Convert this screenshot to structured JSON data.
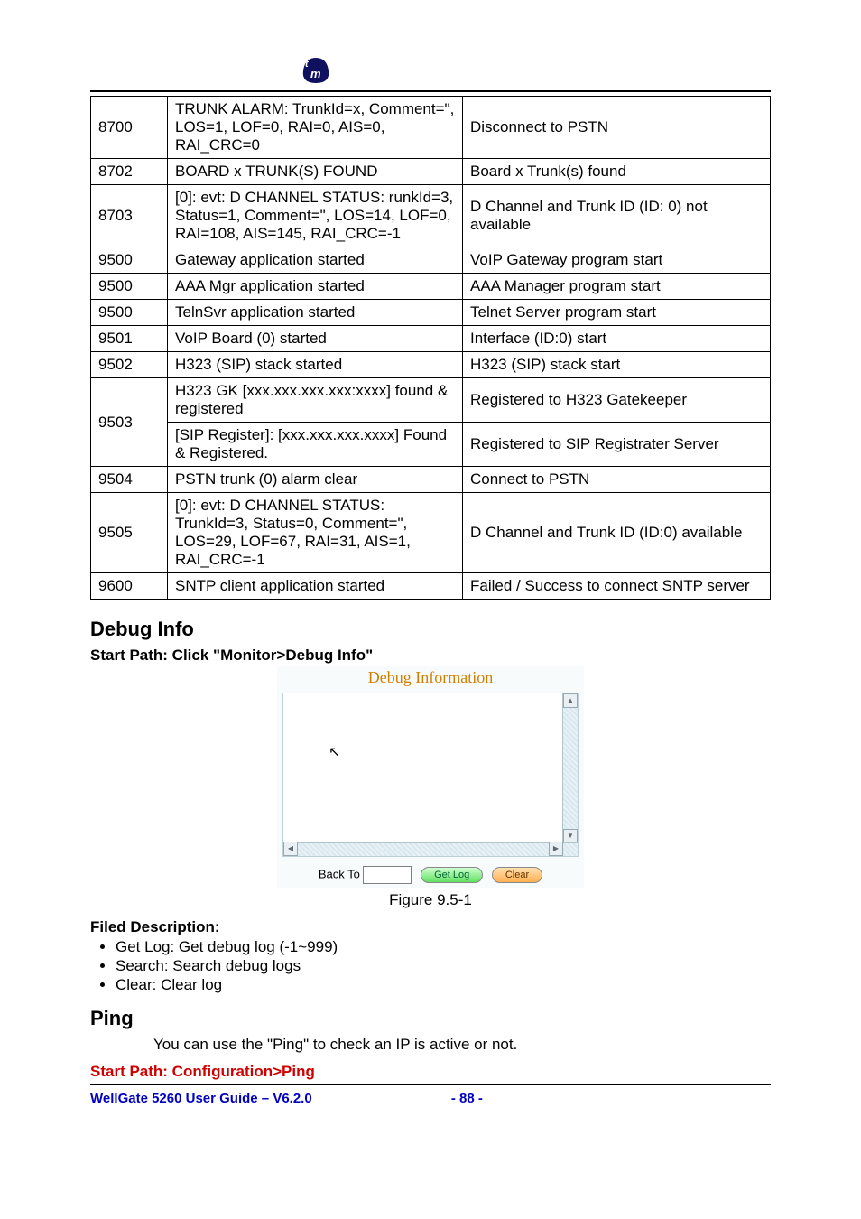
{
  "table": {
    "rows": [
      {
        "code": "8700",
        "msg": "TRUNK ALARM: TrunkId=x, Comment=\", LOS=1, LOF=0, RAI=0, AIS=0, RAI_CRC=0",
        "desc": "Disconnect to PSTN"
      },
      {
        "code": "8702",
        "msg": "BOARD x TRUNK(S) FOUND",
        "desc": "Board x Trunk(s) found"
      },
      {
        "code": "8703",
        "msg": "[0]: evt: D CHANNEL STATUS: runkId=3, Status=1, Comment=\", LOS=14, LOF=0, RAI=108, AIS=145, RAI_CRC=-1",
        "desc": "D Channel and Trunk ID (ID: 0) not available"
      },
      {
        "code": "9500",
        "msg": "Gateway application started",
        "desc": "VoIP Gateway program start"
      },
      {
        "code": "9500",
        "msg": "AAA Mgr application started",
        "desc": "AAA Manager program start"
      },
      {
        "code": "9500",
        "msg": "TelnSvr application started",
        "desc": "Telnet Server program start"
      },
      {
        "code": "9501",
        "msg": "VoIP Board (0) started",
        "desc": "Interface (ID:0) start"
      },
      {
        "code": "9502",
        "msg": "H323 (SIP) stack started",
        "desc": "H323 (SIP) stack start"
      },
      {
        "code": "9503",
        "rows": [
          {
            "msg": "H323 GK [xxx.xxx.xxx.xxx:xxxx] found & registered",
            "desc": "Registered to H323 Gatekeeper"
          },
          {
            "msg": "[SIP Register]: [xxx.xxx.xxx.xxxx] Found & Registered.",
            "desc": "Registered to SIP Registrater Server"
          }
        ]
      },
      {
        "code": "9504",
        "msg": "PSTN trunk (0) alarm clear",
        "desc": "Connect to PSTN"
      },
      {
        "code": "9505",
        "msg": "[0]: evt: D CHANNEL STATUS: TrunkId=3, Status=0, Comment=\", LOS=29, LOF=67, RAI=31, AIS=1, RAI_CRC=-1",
        "desc": "D Channel and Trunk ID (ID:0) available"
      },
      {
        "code": "9600",
        "msg": "SNTP client application started",
        "desc": "Failed / Success to connect SNTP server"
      }
    ]
  },
  "debug": {
    "section_title": "Debug Info",
    "start_path": "Start Path: Click \"Monitor>Debug Info\"",
    "panel_title": "Debug Information",
    "back_to_label": "Back To",
    "get_log_btn": "Get Log",
    "clear_btn": "Clear",
    "figure_caption": "Figure 9.5-1",
    "filed_desc": "Filed Description:",
    "bullets": [
      "Get Log: Get debug log (-1~999)",
      "Search: Search debug logs",
      "Clear: Clear log"
    ]
  },
  "ping": {
    "section_title": "Ping",
    "text": "You can use the \"Ping\" to check an IP is active or not.",
    "start_path": "Start Path: Configuration>Ping"
  },
  "footer": {
    "guide": "WellGate 5260 User Guide – V6.2.0",
    "page": "- 88 -"
  }
}
